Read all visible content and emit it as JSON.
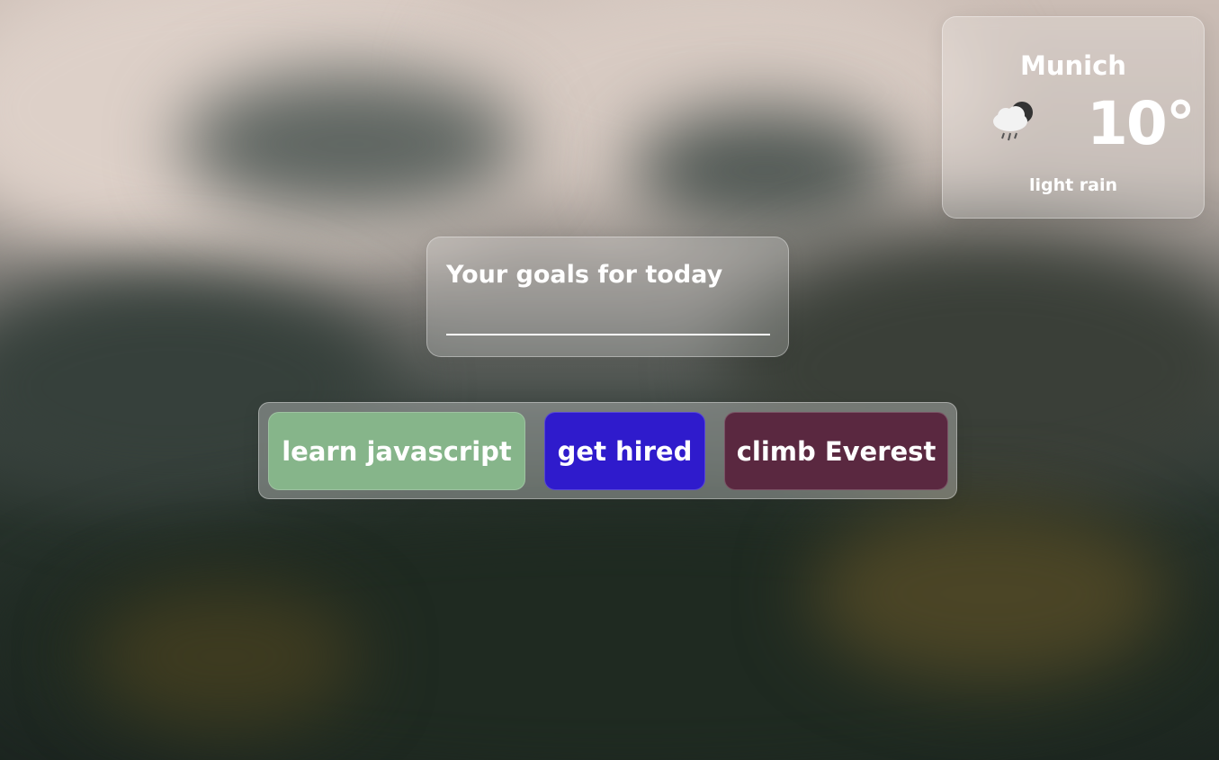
{
  "weather": {
    "city": "Munich",
    "temperature": "10°",
    "description": "light rain",
    "icon": "cloud-rain-moon-icon"
  },
  "goals": {
    "title": "Your goals for today",
    "input_value": "",
    "input_placeholder": ""
  },
  "goal_items": [
    {
      "label": "learn javascript",
      "color": "#86b58a"
    },
    {
      "label": "get hired",
      "color": "#2f1bcc"
    },
    {
      "label": "climb Everest",
      "color": "#5a2840"
    }
  ]
}
